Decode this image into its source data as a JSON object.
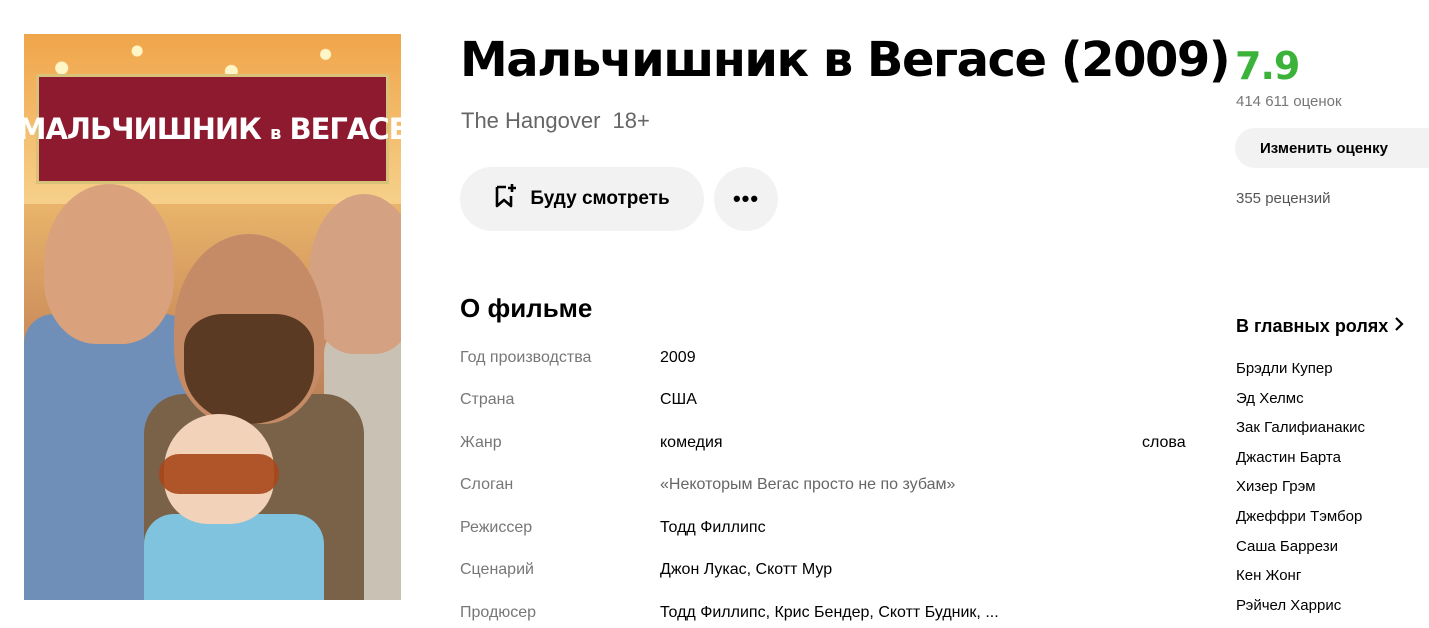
{
  "poster": {
    "title_text": "МАЛЬЧИШНИК",
    "title_small": "в",
    "title_text2": "ВЕГАСЕ"
  },
  "movie": {
    "title": "Мальчишник в Вегасе (2009)",
    "original_title": "The Hangover",
    "age_rating": "18+"
  },
  "actions": {
    "watch_later_label": "Буду смотреть",
    "more_label": "•••"
  },
  "about": {
    "heading": "О фильме",
    "rows": [
      {
        "label": "Год производства",
        "value": "2009"
      },
      {
        "label": "Страна",
        "value": "США"
      },
      {
        "label": "Жанр",
        "value": "комедия",
        "extra": "слова"
      },
      {
        "label": "Слоган",
        "value": "«Некоторым Вегас просто не по зубам»"
      },
      {
        "label": "Режиссер",
        "value": "Тодд Филлипс"
      },
      {
        "label": "Сценарий",
        "value": "Джон Лукас, Скотт Мур"
      },
      {
        "label": "Продюсер",
        "value": "Тодд Филлипс, Крис Бендер, Скотт Будник, ..."
      }
    ]
  },
  "rating": {
    "value": "7.9",
    "votes": "414 611 оценок",
    "change_label": "Изменить оценку",
    "reviews": "355 рецензий",
    "color": "#3bb33b"
  },
  "cast": {
    "heading": "В главных ролях",
    "actors": [
      "Брэдли Купер",
      "Эд Хелмс",
      "Зак Галифианакис",
      "Джастин Барта",
      "Хизер Грэм",
      "Джеффри Тэмбор",
      "Саша Баррези",
      "Кен Жонг",
      "Рэйчел Харрис"
    ]
  }
}
